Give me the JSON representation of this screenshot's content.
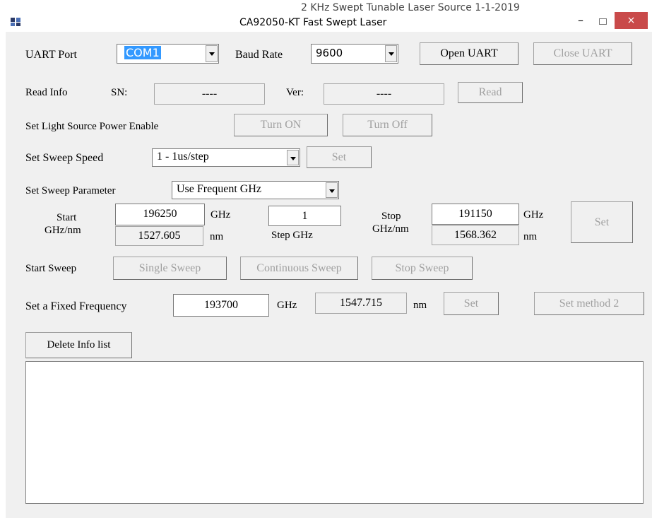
{
  "background_window_title": "2 KHz Swept Tunable Laser Source 1-1-2019",
  "window": {
    "title": "CA92050-KT Fast Swept Laser",
    "minimize": "–",
    "close": "×"
  },
  "uart": {
    "port_label": "UART Port",
    "port_value": "COM1",
    "baud_label": "Baud Rate",
    "baud_value": "9600",
    "open_label": "Open UART",
    "close_label": "Close UART"
  },
  "read_info": {
    "label": "Read Info",
    "sn_label": "SN:",
    "sn_value": "----",
    "ver_label": "Ver:",
    "ver_value": "----",
    "read_label": "Read"
  },
  "power": {
    "label": "Set Light Source Power Enable",
    "on_label": "Turn ON",
    "off_label": "Turn Off"
  },
  "sweep_speed": {
    "label": "Set Sweep Speed",
    "value": "1 - 1us/step",
    "set_label": "Set"
  },
  "sweep_param": {
    "label": "Set Sweep Parameter",
    "mode_value": "Use Frequent GHz",
    "start_label_1": "Start",
    "start_label_2": "GHz/nm",
    "start_ghz": "196250",
    "start_nm": "1527.605",
    "ghz_unit": "GHz",
    "nm_unit": "nm",
    "step_value": "1",
    "step_label": "Step GHz",
    "stop_label_1": "Stop",
    "stop_label_2": "GHz/nm",
    "stop_ghz": "191150",
    "stop_nm": "1568.362",
    "set_label": "Set"
  },
  "start_sweep": {
    "label": "Start Sweep",
    "single_label": "Single Sweep",
    "continuous_label": "Continuous Sweep",
    "stop_label": "Stop Sweep"
  },
  "fixed_freq": {
    "label": "Set a Fixed Frequency",
    "ghz_value": "193700",
    "ghz_unit": "GHz",
    "nm_value": "1547.715",
    "nm_unit": "nm",
    "set_label": "Set",
    "method2_label": "Set method 2"
  },
  "info": {
    "delete_label": "Delete Info list"
  }
}
